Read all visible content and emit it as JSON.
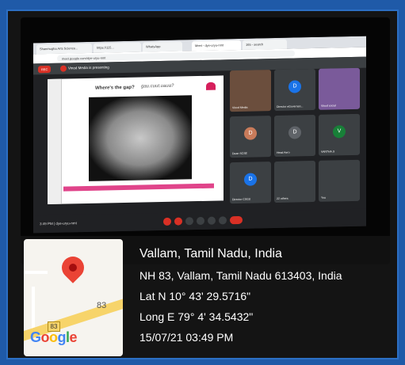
{
  "screen": {
    "tabs": [
      "Shanmugha Arts Science...",
      "https://115...",
      "WhatsApp",
      "Meet - dye-uryu-nmt",
      "165 - search"
    ],
    "address": "meet.google.com/dye-uryu-nmt",
    "rec_label": "REC",
    "presenting_text": "Vinod Media is presenting",
    "slide_title": "Where's the gap?",
    "slide_cursive": "gau.cuut.uaua?",
    "time_code": "3:49 PM  |  dye-uryu-nmt",
    "participants": [
      {
        "name": "Vinod Media",
        "initial": "",
        "color": "#6b4e3d"
      },
      {
        "name": "Director eGovernan...",
        "initial": "D",
        "color": "#1a73e8"
      },
      {
        "name": "Vinod social",
        "initial": "",
        "color": "#7a5a9a"
      },
      {
        "name": "Dean SCSE",
        "initial": "D",
        "color": "#c97b5a"
      },
      {
        "name": "Head Aero",
        "initial": "D",
        "color": "#5f6368"
      },
      {
        "name": "VARTHA.S",
        "initial": "V",
        "color": "#188038"
      },
      {
        "name": "Director CSGS",
        "initial": "D",
        "color": "#1a73e8"
      },
      {
        "name": "22 others",
        "initial": "",
        "color": "#3c4043"
      },
      {
        "name": "You",
        "initial": "",
        "color": "#3c4043"
      }
    ]
  },
  "map": {
    "road_number": "83",
    "shield_number": "83",
    "logo_text": "Google",
    "logo_colors": [
      "#4285f4",
      "#ea4335",
      "#fbbc05",
      "#4285f4",
      "#34a853",
      "#ea4335"
    ]
  },
  "location": {
    "place": "Vallam, Tamil Nadu, India",
    "address": "NH 83, Vallam, Tamil Nadu 613403, India",
    "lat": "Lat N 10° 43' 29.5716\"",
    "long": "Long E 79° 4' 34.5432\"",
    "datetime": "15/07/21 03:49 PM"
  }
}
